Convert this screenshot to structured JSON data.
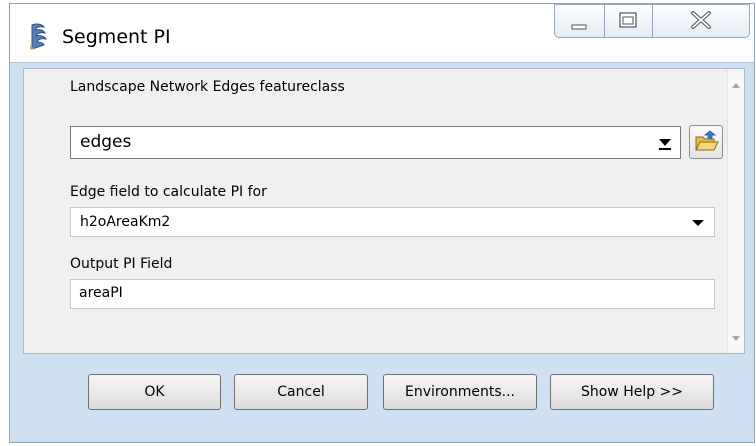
{
  "window": {
    "title": "Segment PI",
    "icons": {
      "app": "script-tool-icon",
      "minimize": "minimize-icon",
      "maximize": "maximize-icon",
      "close": "close-icon"
    }
  },
  "form": {
    "edges_label": "Landscape Network Edges featureclass",
    "edges_value": "edges",
    "edge_field_label": "Edge field to calculate PI for",
    "edge_field_value": "h2oAreaKm2",
    "output_label": "Output PI Field",
    "output_value": "areaPI",
    "browse_icon": "open-folder-icon"
  },
  "buttons": {
    "ok": "OK",
    "cancel": "Cancel",
    "environments": "Environments...",
    "help": "Show Help >>"
  }
}
